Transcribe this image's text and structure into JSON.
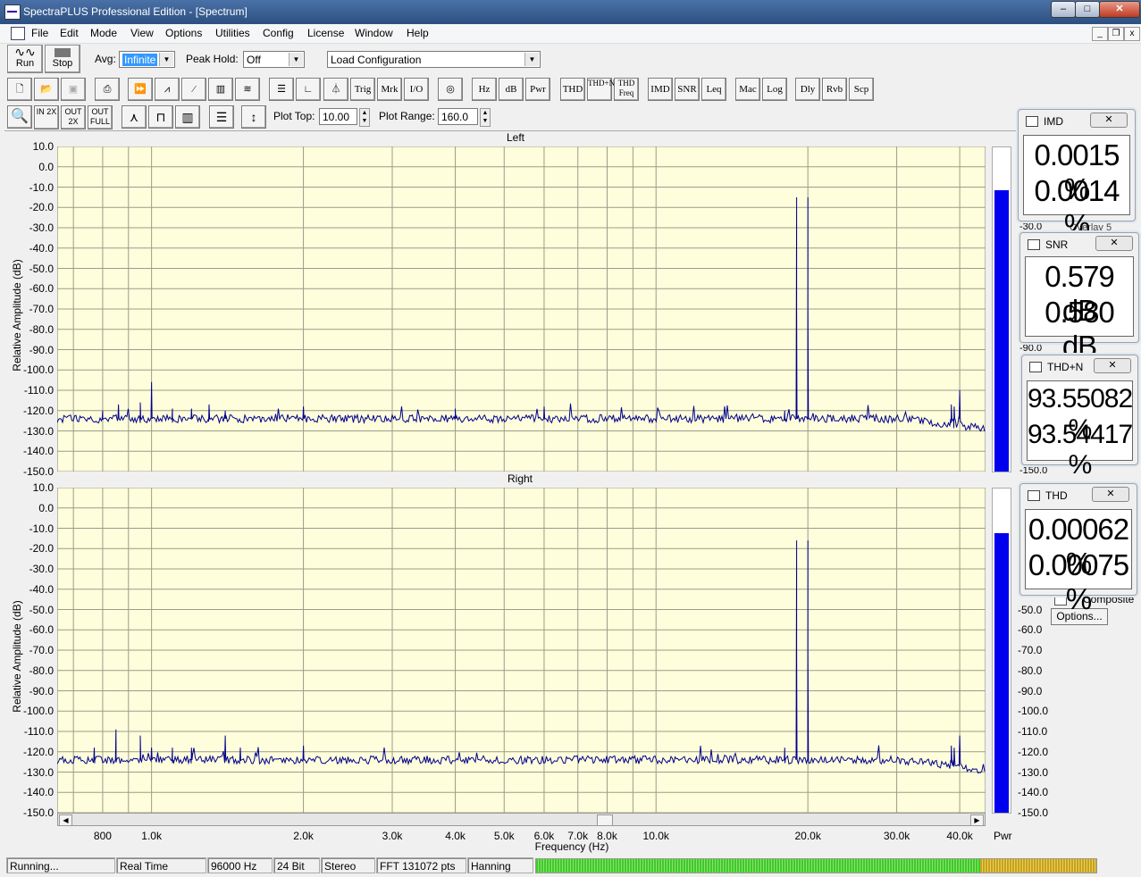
{
  "window": {
    "title": "SpectraPLUS Professional Edition - [Spectrum]"
  },
  "menu": [
    "File",
    "Edit",
    "Mode",
    "View",
    "Options",
    "Utilities",
    "Config",
    "License",
    "Window",
    "Help"
  ],
  "toolbar": {
    "run_label": "Run",
    "stop_label": "Stop",
    "avg_label": "Avg:",
    "avg_value": "Infinite",
    "peak_hold_label": "Peak Hold:",
    "peak_hold_value": "Off",
    "load_config_value": "Load Configuration",
    "buttons": [
      "Trig",
      "Mrk",
      "I/O",
      "Hz",
      "dB",
      "Pwr",
      "THD",
      "THD+N",
      "THD Freq",
      "IMD",
      "SNR",
      "Leq",
      "Mac",
      "Log",
      "Dly",
      "Rvb",
      "Scp"
    ],
    "zoom_in_label": "IN 2X",
    "zoom_out_label": "OUT 2X",
    "zoom_full_label": "OUT FULL",
    "plot_top_label": "Plot Top:",
    "plot_top_value": "10.00",
    "plot_range_label": "Plot Range:",
    "plot_range_value": "160.0"
  },
  "meters": [
    {
      "name": "IMD",
      "values": [
        "0.0015 %",
        "0.0014 %"
      ]
    },
    {
      "name": "SNR",
      "values": [
        "0.579 dB",
        "0.580 dB"
      ]
    },
    {
      "name": "THD+N",
      "values": [
        "93.55082 %",
        "93.54417 %"
      ]
    },
    {
      "name": "THD",
      "values": [
        "0.00062 %",
        "0.00075 %"
      ]
    }
  ],
  "side_panel": {
    "overlay_label": "Overlay 5",
    "composite_label": "Composite",
    "options_label": "Options...",
    "pwr_label": "Pwr",
    "partial_tick_1": "-30.0",
    "partial_tick_2": "-90.0",
    "partial_tick_3": "-150.0"
  },
  "status": {
    "state": "Running...",
    "mode": "Real Time",
    "rate": "96000 Hz",
    "bits": "24 Bit",
    "channels": "Stereo",
    "fft": "FFT 131072 pts",
    "window": "Hanning"
  },
  "chart_data": {
    "type": "line",
    "xlabel": "Frequency (Hz)",
    "ylabel": "Relative Amplitude (dB)",
    "x_scale": "log",
    "xlim": [
      650,
      45000
    ],
    "ylim": [
      -150,
      10
    ],
    "y_ticks": [
      "10.0",
      "0.0",
      "-10.0",
      "-20.0",
      "-30.0",
      "-40.0",
      "-50.0",
      "-60.0",
      "-70.0",
      "-80.0",
      "-90.0",
      "-100.0",
      "-110.0",
      "-120.0",
      "-130.0",
      "-140.0",
      "-150.0"
    ],
    "x_ticks": [
      {
        "v": 800,
        "label": "800"
      },
      {
        "v": 1000,
        "label": "1.0k"
      },
      {
        "v": 2000,
        "label": "2.0k"
      },
      {
        "v": 3000,
        "label": "3.0k"
      },
      {
        "v": 4000,
        "label": "4.0k"
      },
      {
        "v": 5000,
        "label": "5.0k"
      },
      {
        "v": 6000,
        "label": "6.0k"
      },
      {
        "v": 7000,
        "label": "7.0k"
      },
      {
        "v": 8000,
        "label": "8.0k"
      },
      {
        "v": 10000,
        "label": "10.0k"
      },
      {
        "v": 20000,
        "label": "20.0k"
      },
      {
        "v": 30000,
        "label": "30.0k"
      },
      {
        "v": 40000,
        "label": "40.0k"
      }
    ],
    "grid": true,
    "noise_floor_db": -124,
    "series": [
      {
        "name": "Left",
        "color": "#00008b",
        "peaks": [
          [
            800,
            -120
          ],
          [
            860,
            -117
          ],
          [
            950,
            -116
          ],
          [
            1000,
            -106
          ],
          [
            1100,
            -119
          ],
          [
            1200,
            -119
          ],
          [
            1300,
            -117
          ],
          [
            1400,
            -120
          ],
          [
            2000,
            -118
          ],
          [
            4000,
            -119
          ],
          [
            6000,
            -118
          ],
          [
            19000,
            -15
          ],
          [
            20000,
            -15
          ],
          [
            19000,
            -70
          ],
          [
            20000,
            -70
          ],
          [
            18000,
            -120
          ],
          [
            39000,
            -118
          ],
          [
            40000,
            -110
          ],
          [
            38500,
            -117
          ]
        ]
      },
      {
        "name": "Right",
        "color": "#00008b",
        "peaks": [
          [
            770,
            -118
          ],
          [
            850,
            -109
          ],
          [
            950,
            -112
          ],
          [
            1000,
            -118
          ],
          [
            1100,
            -118
          ],
          [
            1200,
            -118
          ],
          [
            1400,
            -112
          ],
          [
            1500,
            -118
          ],
          [
            2000,
            -117
          ],
          [
            19000,
            -16
          ],
          [
            20000,
            -16
          ],
          [
            19000,
            -70
          ],
          [
            20000,
            -70
          ],
          [
            18000,
            -118
          ],
          [
            39000,
            -118
          ],
          [
            40000,
            -112
          ],
          [
            38500,
            -117
          ]
        ]
      }
    ]
  }
}
